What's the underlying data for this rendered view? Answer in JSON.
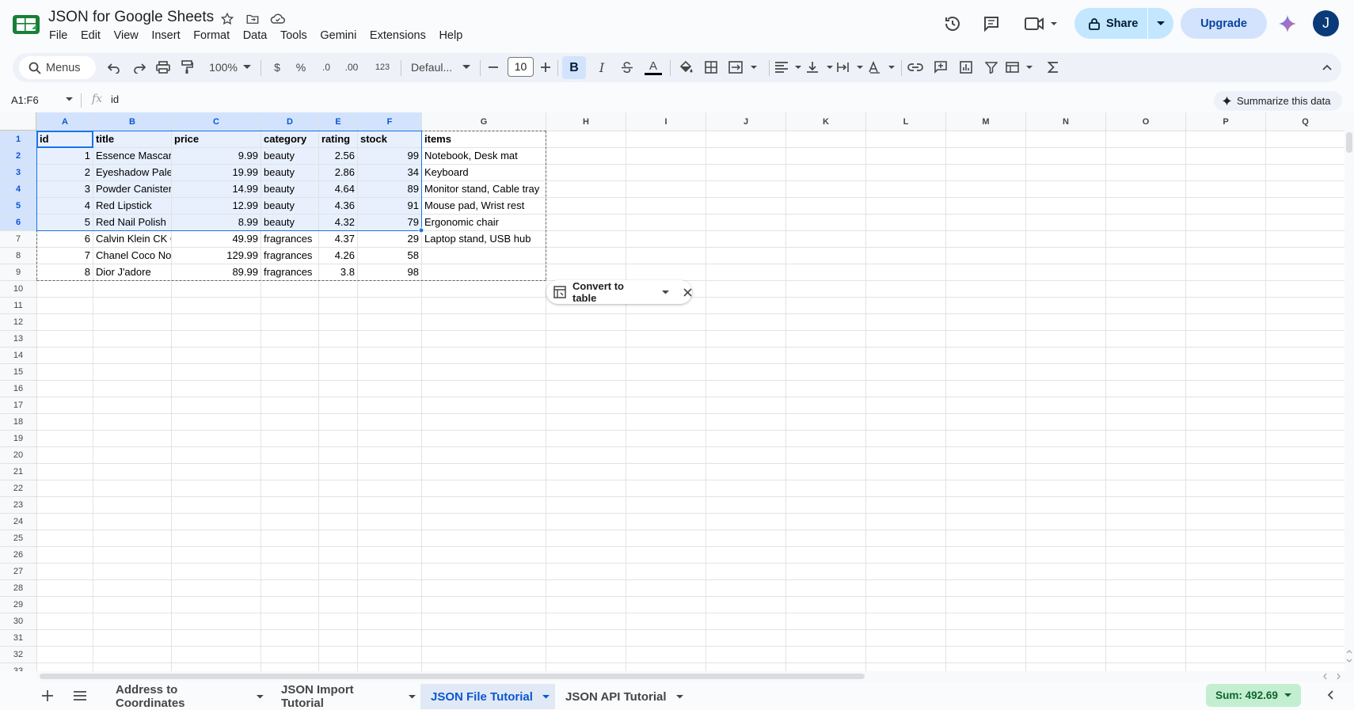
{
  "app": {
    "doc_title": "JSON for Google Sheets",
    "menu": [
      "File",
      "Edit",
      "View",
      "Insert",
      "Format",
      "Data",
      "Tools",
      "Gemini",
      "Extensions",
      "Help"
    ],
    "share_label": "Share",
    "upgrade_label": "Upgrade",
    "avatar_initial": "J"
  },
  "toolbar": {
    "menus_label": "Menus",
    "zoom": "100%",
    "currency": "$",
    "percent": "%",
    "decrease_decimal": ".0",
    "increase_decimal": ".00",
    "number_format": "123",
    "font": "Defaul...",
    "font_size": "10",
    "bold": "B",
    "italic": "I",
    "text_color": "A"
  },
  "formula_bar": {
    "name_box": "A1:F6",
    "fx": "fx",
    "formula": "id",
    "summarize_label": "Summarize this data"
  },
  "sheet": {
    "columns": [
      "A",
      "B",
      "C",
      "D",
      "E",
      "F",
      "G",
      "H",
      "I",
      "J",
      "K",
      "L",
      "M",
      "N",
      "O",
      "P",
      "Q"
    ],
    "row_numbers": [
      "1",
      "2",
      "3",
      "4",
      "5",
      "6",
      "7",
      "8",
      "9",
      "10",
      "11",
      "12",
      "13",
      "14",
      "15",
      "16",
      "17",
      "18",
      "19",
      "20",
      "21",
      "22",
      "23",
      "24",
      "25",
      "26",
      "27",
      "28",
      "29",
      "30",
      "31",
      "32",
      "33"
    ],
    "header": [
      "id",
      "title",
      "price",
      "category",
      "rating",
      "stock",
      "items"
    ],
    "rows": [
      [
        "1",
        "Essence Mascara Lash Princess",
        "9.99",
        "beauty",
        "2.56",
        "99",
        "Notebook, Desk mat"
      ],
      [
        "2",
        "Eyeshadow Palette with Mirror",
        "19.99",
        "beauty",
        "2.86",
        "34",
        "Keyboard"
      ],
      [
        "3",
        "Powder Canister",
        "14.99",
        "beauty",
        "4.64",
        "89",
        "Monitor stand, Cable tray"
      ],
      [
        "4",
        "Red Lipstick",
        "12.99",
        "beauty",
        "4.36",
        "91",
        "Mouse pad, Wrist rest"
      ],
      [
        "5",
        "Red Nail Polish",
        "8.99",
        "beauty",
        "4.32",
        "79",
        "Ergonomic chair"
      ],
      [
        "6",
        "Calvin Klein CK One",
        "49.99",
        "fragrances",
        "4.37",
        "29",
        "Laptop stand, USB hub"
      ],
      [
        "7",
        "Chanel Coco Noir Eau De",
        "129.99",
        "fragrances",
        "4.26",
        "58",
        ""
      ],
      [
        "8",
        "Dior J'adore",
        "89.99",
        "fragrances",
        "3.8",
        "98",
        ""
      ]
    ],
    "convert_label": "Convert to table"
  },
  "bottom": {
    "tabs": [
      "Address to Coordinates",
      "JSON Import Tutorial",
      "JSON File Tutorial",
      "JSON API Tutorial"
    ],
    "active_tab_index": 2,
    "sum_label": "Sum: 492.69"
  },
  "colors": {
    "accent": "#0b57d0",
    "selection": "#d3e3fd",
    "share_bg": "#c2e7ff",
    "sum_bg": "#c4eed0"
  }
}
